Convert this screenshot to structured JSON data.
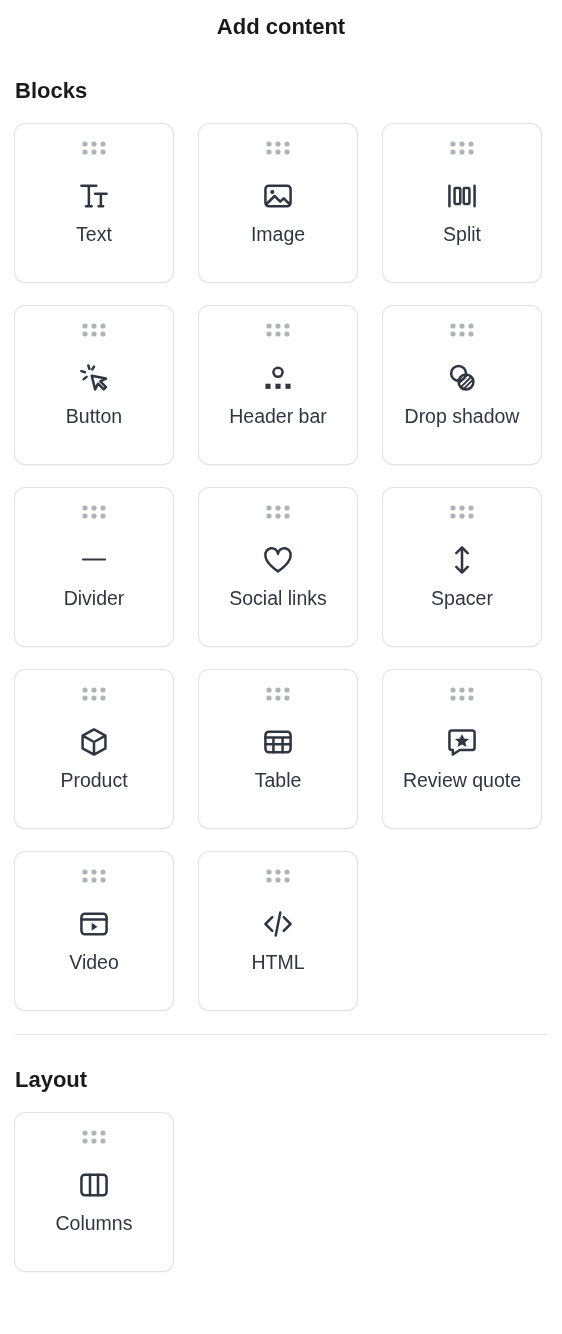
{
  "title": "Add content",
  "sections": [
    {
      "heading": "Blocks",
      "items": [
        {
          "label": "Text",
          "kind": "text"
        },
        {
          "label": "Image",
          "kind": "image"
        },
        {
          "label": "Split",
          "kind": "split"
        },
        {
          "label": "Button",
          "kind": "button"
        },
        {
          "label": "Header bar",
          "kind": "header"
        },
        {
          "label": "Drop shadow",
          "kind": "shadow"
        },
        {
          "label": "Divider",
          "kind": "divider"
        },
        {
          "label": "Social links",
          "kind": "social"
        },
        {
          "label": "Spacer",
          "kind": "spacer"
        },
        {
          "label": "Product",
          "kind": "product"
        },
        {
          "label": "Table",
          "kind": "table"
        },
        {
          "label": "Review quote",
          "kind": "review"
        },
        {
          "label": "Video",
          "kind": "video"
        },
        {
          "label": "HTML",
          "kind": "html"
        }
      ]
    },
    {
      "heading": "Layout",
      "items": [
        {
          "label": "Columns",
          "kind": "columns"
        }
      ]
    }
  ]
}
